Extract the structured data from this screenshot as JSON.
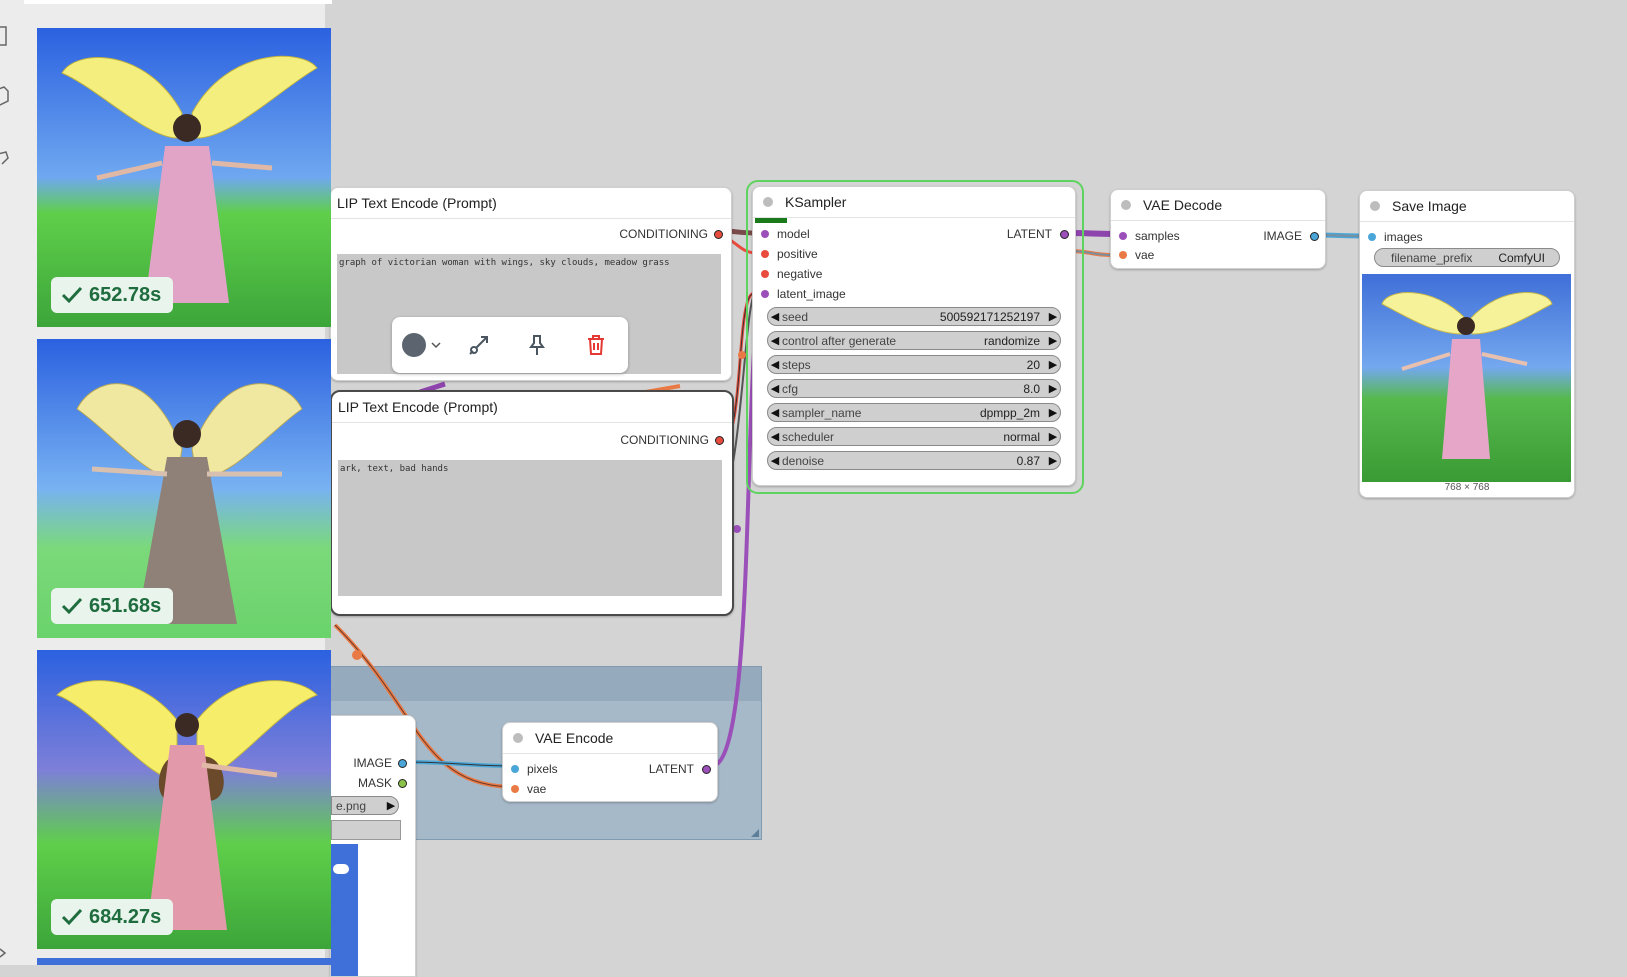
{
  "queue": {
    "items": [
      {
        "time": "652.78s",
        "status": "completed"
      },
      {
        "time": "651.68s",
        "status": "completed"
      },
      {
        "time": "684.27s",
        "status": "completed"
      }
    ]
  },
  "clip_positive": {
    "title": "LIP Text Encode (Prompt)",
    "output": "CONDITIONING",
    "text": "graph of victorian woman with wings, sky clouds, meadow grass"
  },
  "clip_negative": {
    "title": "LIP Text Encode (Prompt)",
    "output": "CONDITIONING",
    "text": "ark, text, bad hands"
  },
  "ksampler": {
    "title": "KSampler",
    "inputs": [
      "model",
      "positive",
      "negative",
      "latent_image"
    ],
    "output": "LATENT",
    "widgets": [
      {
        "label": "seed",
        "value": "500592171252197"
      },
      {
        "label": "control after generate",
        "value": "randomize"
      },
      {
        "label": "steps",
        "value": "20"
      },
      {
        "label": "cfg",
        "value": "8.0"
      },
      {
        "label": "sampler_name",
        "value": "dpmpp_2m"
      },
      {
        "label": "scheduler",
        "value": "normal"
      },
      {
        "label": "denoise",
        "value": "0.87"
      }
    ]
  },
  "vae_decode": {
    "title": "VAE Decode",
    "inputs": [
      "samples",
      "vae"
    ],
    "output": "IMAGE"
  },
  "save_image": {
    "title": "Save Image",
    "input": "images",
    "widget_label": "filename_prefix",
    "widget_value": "ComfyUI",
    "size_label": "768 × 768"
  },
  "vae_encode": {
    "title": "VAE Encode",
    "inputs": [
      "pixels",
      "vae"
    ],
    "output": "LATENT"
  },
  "load_image": {
    "outputs": [
      "IMAGE",
      "MASK"
    ],
    "filename": "e.png"
  },
  "colors": {
    "canvas": "#d4d4d4",
    "selected_outline": "#5fd35f",
    "group_fill": "#9fb4c6",
    "model_link": "#b14fc8",
    "clip_link": "#e8a43a",
    "vae_link": "#ea7a45",
    "image_link": "#4aa6d8",
    "conditioning": "#e74c3c"
  },
  "toolbar_icons": [
    "color-picker-icon",
    "bypass-icon",
    "pin-icon",
    "delete-icon"
  ]
}
